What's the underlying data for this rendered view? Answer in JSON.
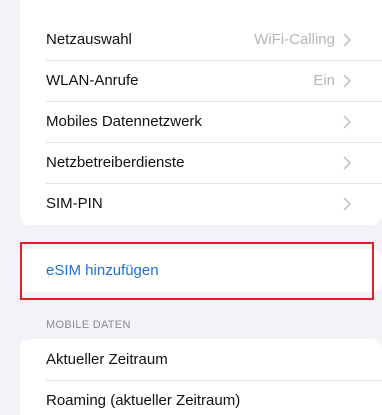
{
  "settings_list": {
    "rows": [
      {
        "label": "Netzauswahl",
        "value": "WiFi-Calling",
        "icon": "chevron-right-icon"
      },
      {
        "label": "WLAN-Anrufe",
        "value": "Ein",
        "icon": "chevron-right-icon"
      },
      {
        "label": "Mobiles Datennetzwerk",
        "value": "",
        "icon": "chevron-right-icon"
      },
      {
        "label": "Netzbetreiberdienste",
        "value": "",
        "icon": "chevron-right-icon"
      },
      {
        "label": "SIM-PIN",
        "value": "",
        "icon": "chevron-right-icon"
      }
    ]
  },
  "esim": {
    "label": "eSIM hinzufügen"
  },
  "mobile_data": {
    "header": "MOBILE DATEN",
    "rows": [
      {
        "label": "Aktueller Zeitraum"
      },
      {
        "label": "Roaming (aktueller Zeitraum)"
      }
    ]
  },
  "colors": {
    "background": "#f2f2f7",
    "link": "#1f6fd1",
    "highlight": "#e0202a",
    "secondary_text": "#b5b5ba"
  }
}
